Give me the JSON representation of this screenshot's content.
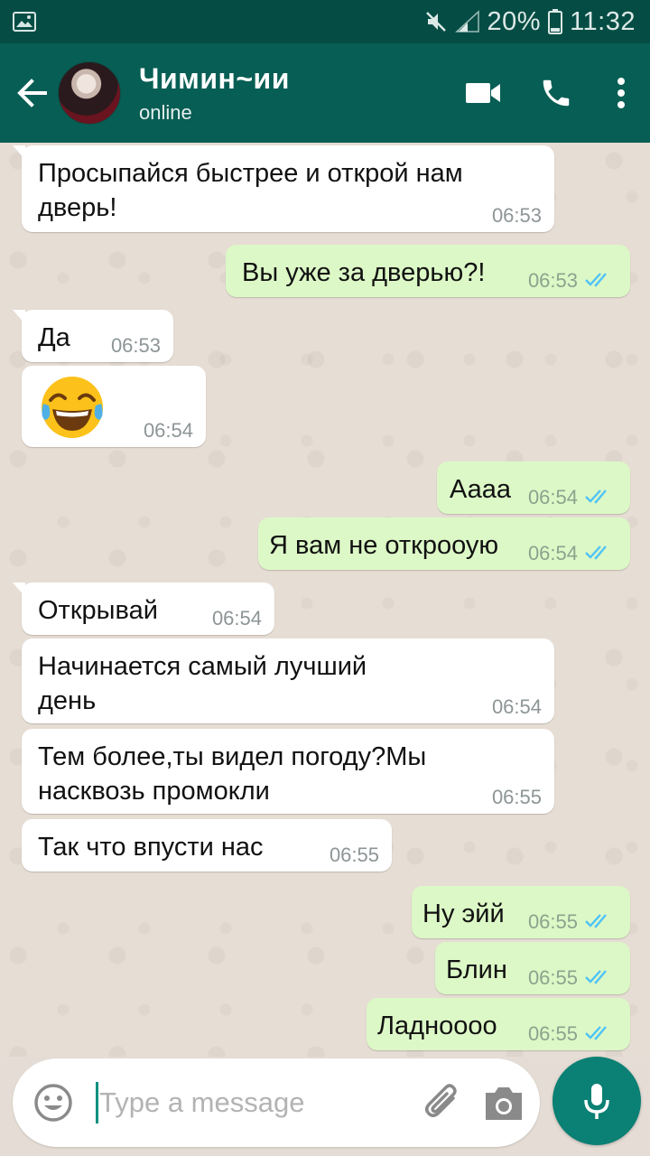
{
  "status_bar": {
    "battery": "20%",
    "time": "11:32"
  },
  "header": {
    "contact_name": "Чимин~ии",
    "contact_status": "online",
    "icons": [
      "back-arrow-icon",
      "video-call-icon",
      "voice-call-icon",
      "more-options-icon"
    ]
  },
  "messages": [
    {
      "dir": "in",
      "text": "Просыпайся быстрее и открой нам\nдверь!",
      "time": "06:53"
    },
    {
      "dir": "out",
      "text": "Вы уже за дверью?!",
      "time": "06:53",
      "status": "read"
    },
    {
      "dir": "in",
      "text": "Да",
      "time": "06:53"
    },
    {
      "dir": "in",
      "text": "",
      "emoji": "face-with-tears-of-joy",
      "time": "06:54"
    },
    {
      "dir": "out",
      "text": "Аааа",
      "time": "06:54",
      "status": "read"
    },
    {
      "dir": "out",
      "text": "Я вам не открооую",
      "time": "06:54",
      "status": "read"
    },
    {
      "dir": "in",
      "text": "Открывай",
      "time": "06:54"
    },
    {
      "dir": "in",
      "text": "Начинается самый лучший\nдень",
      "time": "06:54"
    },
    {
      "dir": "in",
      "text": "Тем более,ты видел погоду?Мы\nнасквозь промокли",
      "time": "06:55"
    },
    {
      "dir": "in",
      "text": "Так что впусти нас",
      "time": "06:55"
    },
    {
      "dir": "out",
      "text": "Ну эйй",
      "time": "06:55",
      "status": "read"
    },
    {
      "dir": "out",
      "text": "Блин",
      "time": "06:55",
      "status": "read"
    },
    {
      "dir": "out",
      "text": "Ладноооо",
      "time": "06:55",
      "status": "read"
    }
  ],
  "composer": {
    "placeholder": "Type a message",
    "value": ""
  },
  "colors": {
    "status_bar": "#054d44",
    "app_bar": "#075e54",
    "outgoing_bubble": "#dcf8c6",
    "incoming_bubble": "#ffffff",
    "read_ticks": "#4fc3f7",
    "mic_button": "#0b8074"
  }
}
